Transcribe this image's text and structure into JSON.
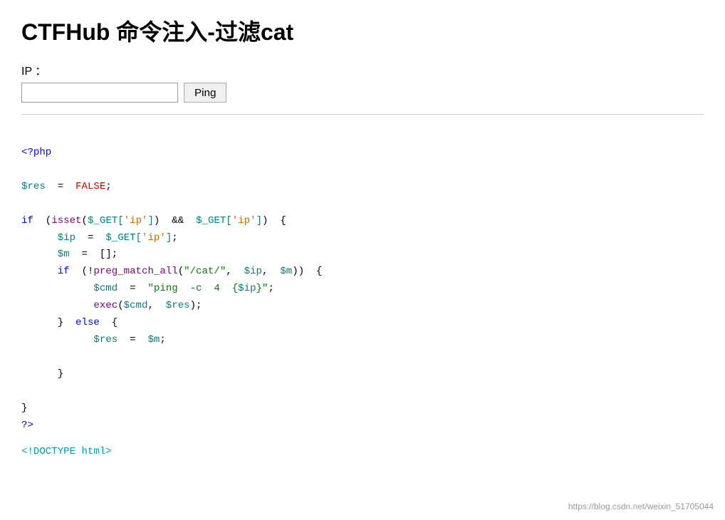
{
  "header": {
    "title": "CTFHub 命令注入-过滤cat"
  },
  "form": {
    "ip_label": "IP ：",
    "ip_placeholder": "",
    "ping_button": "Ping"
  },
  "code": {
    "php_open": "<?php",
    "line_res": "$res  =  FALSE;",
    "line_if": "if  (isset($_GET['ip'])  &&  $_GET['ip'])  {",
    "line_ip": "$ip  =  $_GET['ip'];",
    "line_m": "$m  =  [];",
    "line_ifcat": "if  (!preg_match_all(\"/cat/\",  $ip,  $m))  {",
    "line_cmd": "$cmd  =  \"ping  -c  4  {$ip}\";",
    "line_exec": "exec($cmd,  $res);",
    "line_else": "}  else  {",
    "line_resm": "$res  =  $m;",
    "line_close_inner": "}",
    "line_close_outer": "}",
    "php_close": "?>",
    "doctype": "<!DOCTYPE  html>"
  },
  "watermark": "https://blog.csdn.net/weixin_51705044"
}
